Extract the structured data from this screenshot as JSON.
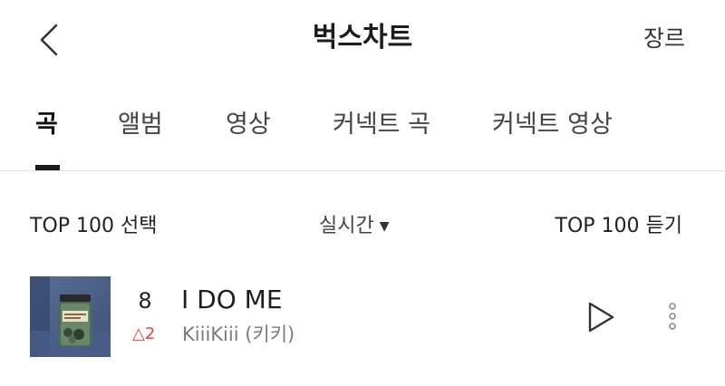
{
  "header": {
    "back_icon": "chevron-left-icon",
    "title": "벅스차트",
    "genre_label": "장르"
  },
  "tabs": [
    {
      "label": "곡",
      "active": true
    },
    {
      "label": "앨범",
      "active": false
    },
    {
      "label": "영상",
      "active": false
    },
    {
      "label": "커넥트 곡",
      "active": false
    },
    {
      "label": "커넥트 영상",
      "active": false
    }
  ],
  "controls": {
    "top100_select": "TOP 100 선택",
    "period_label": "실시간",
    "period_icon": "caret-down-icon",
    "top100_listen": "TOP 100 듣기"
  },
  "song": {
    "rank": "8",
    "change_symbol": "△",
    "change_value": "2",
    "title": "I DO ME",
    "artist": "KiiiKiii (키키)",
    "play_icon": "play-icon",
    "more_icon": "more-vertical-icon"
  },
  "colors": {
    "rank_up": "#e0463e",
    "text_primary": "#1a1a1a",
    "text_secondary": "#7a7a7a",
    "divider": "#e4e4e4"
  }
}
